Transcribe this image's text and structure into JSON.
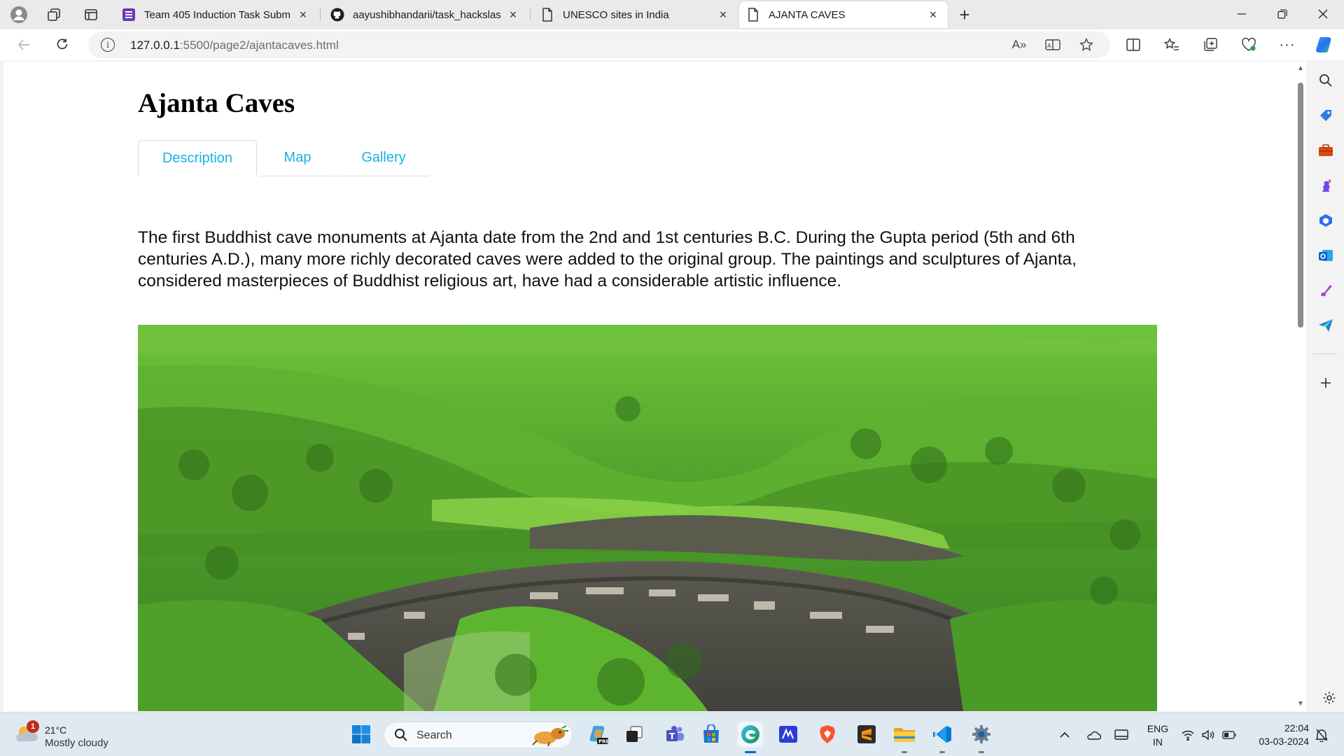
{
  "browser": {
    "tabs": [
      {
        "title": "Team 405 Induction Task Submission",
        "favicon": "forms-icon",
        "active": false
      },
      {
        "title": "aayushibhandarii/task_hackslash",
        "favicon": "github-icon",
        "active": false
      },
      {
        "title": "UNESCO sites in India",
        "favicon": "page-icon",
        "active": false
      },
      {
        "title": "AJANTA CAVES",
        "favicon": "page-icon",
        "active": true
      }
    ],
    "new_tab_label": "+",
    "address": {
      "url_host": "127.0.0.1",
      "url_rest": ":5500/page2/ajantacaves.html",
      "read_aloud_label": "A»"
    }
  },
  "page": {
    "title": "Ajanta Caves",
    "tabs": [
      {
        "label": "Description",
        "active": true
      },
      {
        "label": "Map",
        "active": false
      },
      {
        "label": "Gallery",
        "active": false
      }
    ],
    "description": "The first Buddhist cave monuments at Ajanta date from the 2nd and 1st centuries B.C. During the Gupta period (5th and 6th centuries A.D.), many more richly decorated caves were added to the original group. The paintings and sculptures of Ajanta, considered masterpieces of Buddhist religious art, have had a considerable artistic influence.",
    "tab_color": "#1bb0e6"
  },
  "taskbar": {
    "weather": {
      "temp": "21°C",
      "desc": "Mostly cloudy",
      "badge": "1"
    },
    "search_label": "Search",
    "tray": {
      "lang_top": "ENG",
      "lang_bottom": "IN",
      "time": "22:04",
      "date": "03-03-2024"
    }
  }
}
